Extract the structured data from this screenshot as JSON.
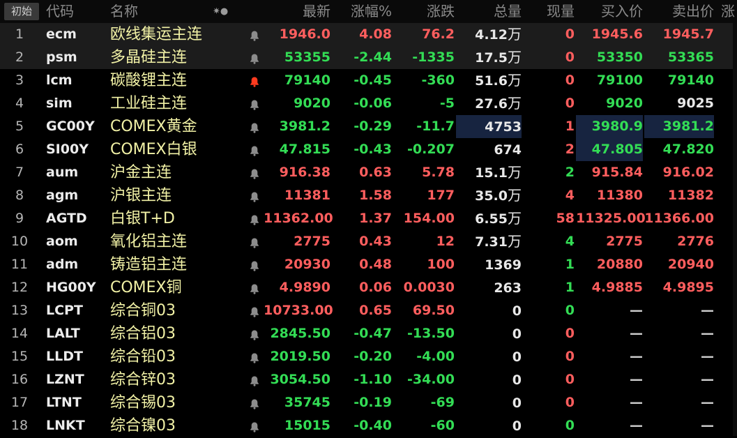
{
  "header": {
    "start_label": "初始",
    "columns": {
      "code": "代码",
      "name": "名称",
      "last": "最新",
      "pct": "涨幅%",
      "chg": "涨跌",
      "vol": "总量",
      "cur": "现量",
      "bid": "买入价",
      "ask": "卖出价",
      "more": "涨"
    },
    "sort_icon": "✷●"
  },
  "colors": {
    "up": "#ff5e5e",
    "down": "#33dd55",
    "flat": "#e8e8e8",
    "name": "#f2f2a6",
    "highlight": "#172440"
  },
  "rows": [
    {
      "idx": "1",
      "code": "ecm",
      "name": "欧线集运主连",
      "last": "1946.0",
      "pct": "4.08",
      "chg": "76.2",
      "vol": "4.12",
      "vol_unit": "万",
      "cur": "0",
      "bid": "1945.6",
      "ask": "1945.7",
      "dir": "up",
      "cur_dir": "up",
      "bid_dir": "up",
      "ask_dir": "up",
      "bell": "grey",
      "selected": true
    },
    {
      "idx": "2",
      "code": "psm",
      "name": "多晶硅主连",
      "last": "53355",
      "pct": "-2.44",
      "chg": "-1335",
      "vol": "17.5",
      "vol_unit": "万",
      "cur": "0",
      "bid": "53350",
      "ask": "53365",
      "dir": "down",
      "cur_dir": "up",
      "bid_dir": "down",
      "ask_dir": "down",
      "bell": "grey",
      "selected": true
    },
    {
      "idx": "3",
      "code": "lcm",
      "name": "碳酸锂主连",
      "last": "79140",
      "pct": "-0.45",
      "chg": "-360",
      "vol": "51.6",
      "vol_unit": "万",
      "cur": "0",
      "bid": "79100",
      "ask": "79140",
      "dir": "down",
      "cur_dir": "up",
      "bid_dir": "down",
      "ask_dir": "down",
      "bell": "red"
    },
    {
      "idx": "4",
      "code": "sim",
      "name": "工业硅主连",
      "last": "9020",
      "pct": "-0.06",
      "chg": "-5",
      "vol": "27.6",
      "vol_unit": "万",
      "cur": "0",
      "bid": "9020",
      "ask": "9025",
      "dir": "down",
      "cur_dir": "up",
      "bid_dir": "down",
      "ask_dir": "flat",
      "bell": "grey"
    },
    {
      "idx": "5",
      "code": "GC00Y",
      "name": "COMEX黄金",
      "last": "3981.2",
      "pct": "-0.29",
      "chg": "-11.7",
      "vol": "4753",
      "vol_unit": "",
      "cur": "1",
      "bid": "3980.9",
      "ask": "3981.2",
      "dir": "down",
      "cur_dir": "up",
      "bid_dir": "down",
      "ask_dir": "down",
      "bell": "grey",
      "hl_vol": true,
      "hl_bid": true,
      "hl_ask": true
    },
    {
      "idx": "6",
      "code": "SI00Y",
      "name": "COMEX白银",
      "last": "47.815",
      "pct": "-0.43",
      "chg": "-0.207",
      "vol": "674",
      "vol_unit": "",
      "cur": "2",
      "bid": "47.805",
      "ask": "47.820",
      "dir": "down",
      "cur_dir": "up",
      "bid_dir": "down",
      "ask_dir": "down",
      "bell": "grey",
      "hl_bid": true
    },
    {
      "idx": "7",
      "code": "aum",
      "name": "沪金主连",
      "last": "916.38",
      "pct": "0.63",
      "chg": "5.78",
      "vol": "15.1",
      "vol_unit": "万",
      "cur": "2",
      "bid": "915.84",
      "ask": "916.02",
      "dir": "up",
      "cur_dir": "down",
      "bid_dir": "up",
      "ask_dir": "up",
      "bell": "grey"
    },
    {
      "idx": "8",
      "code": "agm",
      "name": "沪银主连",
      "last": "11381",
      "pct": "1.58",
      "chg": "177",
      "vol": "35.0",
      "vol_unit": "万",
      "cur": "4",
      "bid": "11380",
      "ask": "11382",
      "dir": "up",
      "cur_dir": "up",
      "bid_dir": "up",
      "ask_dir": "up",
      "bell": "grey"
    },
    {
      "idx": "9",
      "code": "AGTD",
      "name": "白银T+D",
      "last": "11362.00",
      "pct": "1.37",
      "chg": "154.00",
      "vol": "6.55",
      "vol_unit": "万",
      "cur": "58",
      "bid": "11325.00",
      "ask": "11366.00",
      "dir": "up",
      "cur_dir": "up",
      "bid_dir": "up",
      "ask_dir": "up",
      "bell": "grey"
    },
    {
      "idx": "10",
      "code": "aom",
      "name": "氧化铝主连",
      "last": "2775",
      "pct": "0.43",
      "chg": "12",
      "vol": "7.31",
      "vol_unit": "万",
      "cur": "4",
      "bid": "2775",
      "ask": "2776",
      "dir": "up",
      "cur_dir": "down",
      "bid_dir": "up",
      "ask_dir": "up",
      "bell": "grey"
    },
    {
      "idx": "11",
      "code": "adm",
      "name": "铸造铝主连",
      "last": "20930",
      "pct": "0.48",
      "chg": "100",
      "vol": "1369",
      "vol_unit": "",
      "cur": "1",
      "bid": "20880",
      "ask": "20940",
      "dir": "up",
      "cur_dir": "down",
      "bid_dir": "up",
      "ask_dir": "up",
      "bell": "grey"
    },
    {
      "idx": "12",
      "code": "HG00Y",
      "name": "COMEX铜",
      "last": "4.9890",
      "pct": "0.06",
      "chg": "0.0030",
      "vol": "263",
      "vol_unit": "",
      "cur": "1",
      "bid": "4.9885",
      "ask": "4.9895",
      "dir": "up",
      "cur_dir": "down",
      "bid_dir": "up",
      "ask_dir": "up",
      "bell": "grey"
    },
    {
      "idx": "13",
      "code": "LCPT",
      "name": "综合铜03",
      "last": "10733.00",
      "pct": "0.65",
      "chg": "69.50",
      "vol": "0",
      "vol_unit": "",
      "cur": "0",
      "bid": "—",
      "ask": "—",
      "dir": "up",
      "cur_dir": "down",
      "bid_dir": "dash",
      "ask_dir": "dash",
      "bell": "grey"
    },
    {
      "idx": "14",
      "code": "LALT",
      "name": "综合铝03",
      "last": "2845.50",
      "pct": "-0.47",
      "chg": "-13.50",
      "vol": "0",
      "vol_unit": "",
      "cur": "0",
      "bid": "—",
      "ask": "—",
      "dir": "down",
      "cur_dir": "up",
      "bid_dir": "dash",
      "ask_dir": "dash",
      "bell": "grey"
    },
    {
      "idx": "15",
      "code": "LLDT",
      "name": "综合铅03",
      "last": "2019.50",
      "pct": "-0.20",
      "chg": "-4.00",
      "vol": "0",
      "vol_unit": "",
      "cur": "0",
      "bid": "—",
      "ask": "—",
      "dir": "down",
      "cur_dir": "up",
      "bid_dir": "dash",
      "ask_dir": "dash",
      "bell": "grey"
    },
    {
      "idx": "16",
      "code": "LZNT",
      "name": "综合锌03",
      "last": "3054.50",
      "pct": "-1.10",
      "chg": "-34.00",
      "vol": "0",
      "vol_unit": "",
      "cur": "0",
      "bid": "—",
      "ask": "—",
      "dir": "down",
      "cur_dir": "up",
      "bid_dir": "dash",
      "ask_dir": "dash",
      "bell": "grey"
    },
    {
      "idx": "17",
      "code": "LTNT",
      "name": "综合锡03",
      "last": "35745",
      "pct": "-0.19",
      "chg": "-69",
      "vol": "0",
      "vol_unit": "",
      "cur": "0",
      "bid": "—",
      "ask": "—",
      "dir": "down",
      "cur_dir": "up",
      "bid_dir": "dash",
      "ask_dir": "dash",
      "bell": "grey"
    },
    {
      "idx": "18",
      "code": "LNKT",
      "name": "综合镍03",
      "last": "15015",
      "pct": "-0.40",
      "chg": "-60",
      "vol": "0",
      "vol_unit": "",
      "cur": "0",
      "bid": "—",
      "ask": "—",
      "dir": "down",
      "cur_dir": "down",
      "bid_dir": "dash",
      "ask_dir": "dash",
      "bell": "grey"
    }
  ]
}
